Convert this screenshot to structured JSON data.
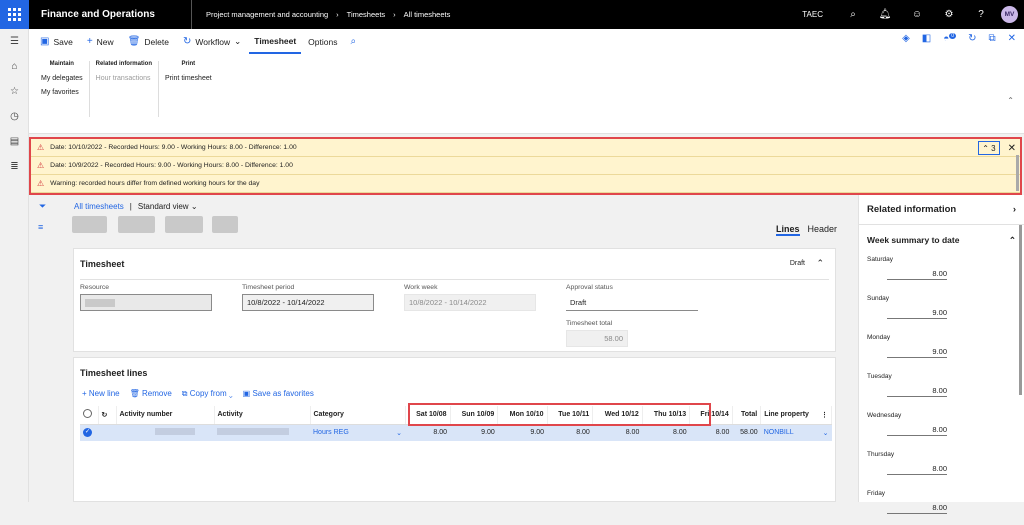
{
  "topbar": {
    "app_name": "Finance and Operations",
    "breadcrumb": [
      "Project management and accounting",
      "Timesheets",
      "All timesheets"
    ],
    "company": "TAEC",
    "avatar_initials": "MV"
  },
  "commands": {
    "save": "Save",
    "new": "New",
    "delete": "Delete",
    "workflow": "Workflow",
    "tab_timesheet": "Timesheet",
    "tab_options": "Options",
    "badge_count": "0"
  },
  "ribbon": {
    "maintain_title": "Maintain",
    "my_delegates": "My delegates",
    "my_favorites": "My favorites",
    "related_title": "Related information",
    "hour_transactions": "Hour transactions",
    "print_title": "Print",
    "print_timesheet": "Print timesheet"
  },
  "messages": {
    "count": "3",
    "items": [
      "Date: 10/10/2022 - Recorded Hours: 9.00 - Working Hours: 8.00 - Difference: 1.00",
      "Date: 10/9/2022 - Recorded Hours: 9.00 - Working Hours: 8.00 - Difference: 1.00",
      "Warning: recorded hours differ from defined working hours for the day"
    ]
  },
  "view": {
    "all_timesheets": "All timesheets",
    "separator": "|",
    "standard_view": "Standard view",
    "lines_tab": "Lines",
    "header_tab": "Header"
  },
  "timesheet": {
    "title": "Timesheet",
    "status": "Draft",
    "resource_label": "Resource",
    "period_label": "Timesheet period",
    "period_value": "10/8/2022 - 10/14/2022",
    "week_label": "Work week",
    "week_value": "10/8/2022 - 10/14/2022",
    "approval_label": "Approval status",
    "approval_value": "Draft",
    "total_label": "Timesheet total",
    "total_value": "58.00"
  },
  "lines": {
    "title": "Timesheet lines",
    "new_line": "New line",
    "remove": "Remove",
    "copy_from": "Copy from",
    "save_favorites": "Save as favorites",
    "headers": [
      "Activity number",
      "Activity",
      "Category",
      "Sat 10/08",
      "Sun 10/09",
      "Mon 10/10",
      "Tue 10/11",
      "Wed 10/12",
      "Thu 10/13",
      "Fri 10/14",
      "Total",
      "Line property"
    ],
    "row": {
      "category": "Hours REG",
      "hours": [
        "8.00",
        "9.00",
        "9.00",
        "8.00",
        "8.00",
        "8.00",
        "8.00"
      ],
      "total": "58.00",
      "line_property": "NONBILL"
    }
  },
  "related": {
    "title": "Related information",
    "week_summary": "Week summary to date",
    "days": [
      {
        "name": "Saturday",
        "value": "8.00"
      },
      {
        "name": "Sunday",
        "value": "9.00"
      },
      {
        "name": "Monday",
        "value": "9.00"
      },
      {
        "name": "Tuesday",
        "value": "8.00"
      },
      {
        "name": "Wednesday",
        "value": "8.00"
      },
      {
        "name": "Thursday",
        "value": "8.00"
      },
      {
        "name": "Friday",
        "value": "8.00"
      }
    ]
  }
}
